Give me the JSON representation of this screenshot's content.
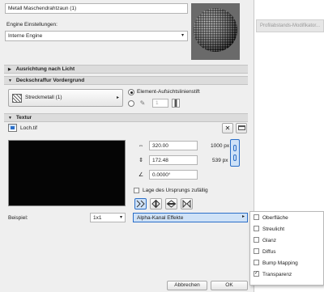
{
  "material_name": "Metall Maschendrahtzaun (1)",
  "engine": {
    "label": "Engine Einstellungen:",
    "value": "Interne Engine"
  },
  "right_panel": {
    "tab_label": "Profilabstands-Modifikator..."
  },
  "sections": {
    "ausrichtung": "Ausrichtung nach Licht",
    "deckschraffur": "Deckschraffur Vordergrund",
    "textur": "Textur"
  },
  "hatch": {
    "fill_name": "Streckmetall (1)",
    "radio_label": "Element-Aufsichtslinienstift",
    "pen_number": "1"
  },
  "texture": {
    "file_name": "Loch.tif",
    "width_value": "320.00",
    "height_value": "172.48",
    "angle_value": "0.0000°",
    "width_px": "1000 px",
    "height_px": "539 px",
    "random_origin_label": "Lage des Ursprungs zufällig"
  },
  "example": {
    "label": "Beispiel:",
    "zoom_value": "1x1"
  },
  "alpha": {
    "label": "Alpha-Kanal Effekte",
    "items": [
      {
        "label": "Oberfläche",
        "checked": false
      },
      {
        "label": "Streulicht",
        "checked": false
      },
      {
        "label": "Glanz",
        "checked": false
      },
      {
        "label": "Diffus",
        "checked": false
      },
      {
        "label": "Bump Mapping",
        "checked": false
      },
      {
        "label": "Transparenz",
        "checked": true
      }
    ]
  },
  "footer": {
    "cancel_label": "Abbrechen",
    "ok_label": "OK"
  },
  "colors": {
    "accent": "#2a6ec8",
    "highlight": "#cfe2f7",
    "section": "#dcdcdc"
  }
}
